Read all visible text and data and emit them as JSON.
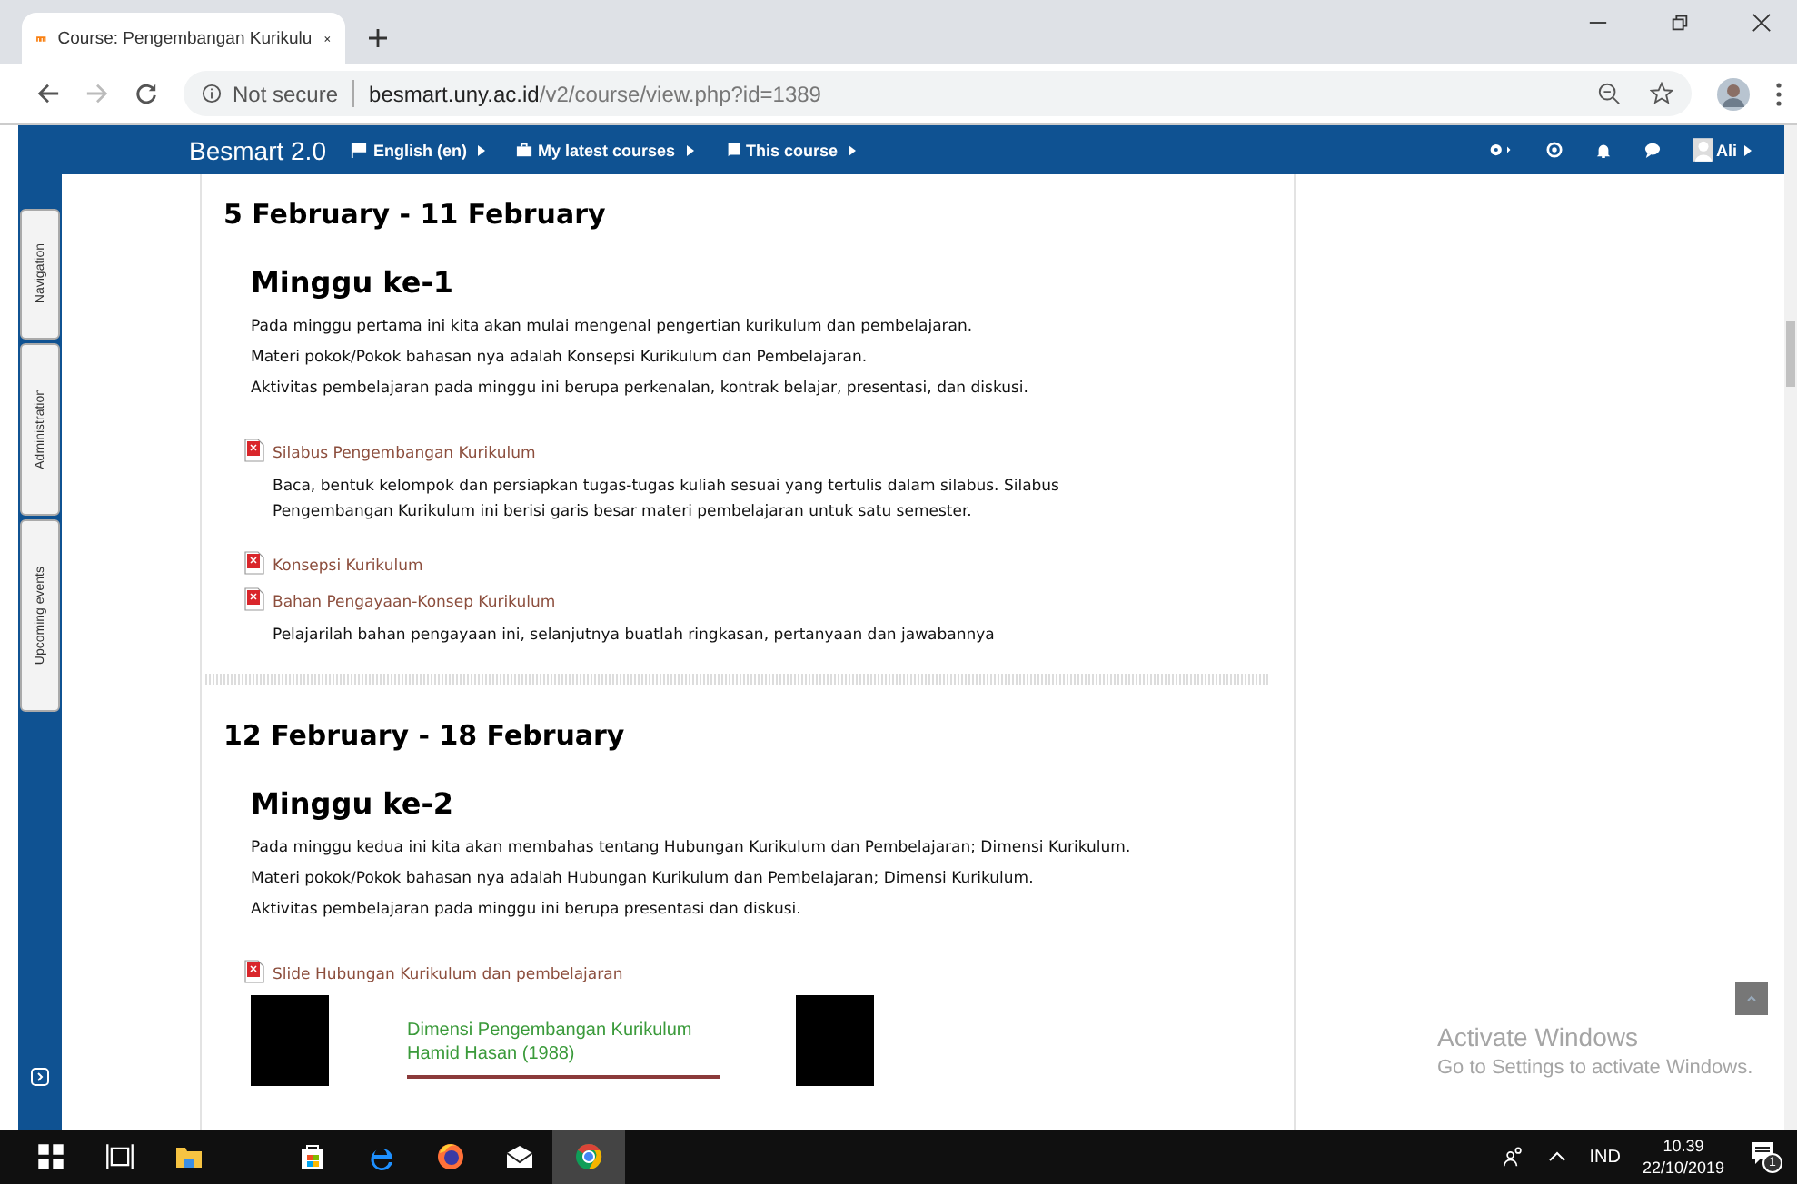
{
  "browser": {
    "tab_title": "Course: Pengembangan Kurikulu",
    "security": "Not secure",
    "url_host": "besmart.uny.ac.id",
    "url_path": "/v2/course/view.php?id=1389"
  },
  "navbar": {
    "brand": "Besmart 2.0",
    "menus": [
      {
        "kind": "flag",
        "label": "English (en)"
      },
      {
        "kind": "briefcase",
        "label": "My latest courses"
      },
      {
        "kind": "book",
        "label": "This course"
      }
    ],
    "user": "Ali"
  },
  "side_tabs": [
    "Navigation",
    "Administration",
    "Upcoming events"
  ],
  "sections": [
    {
      "date": "5 February - 11 February",
      "title": "Minggu ke-1",
      "paragraphs": [
        "Pada minggu pertama ini kita akan mulai mengenal pengertian kurikulum dan pembelajaran.",
        "Materi pokok/Pokok bahasan nya adalah Konsepsi Kurikulum dan Pembelajaran.",
        "Aktivitas pembelajaran pada minggu ini berupa perkenalan, kontrak belajar, presentasi, dan diskusi."
      ],
      "resources": [
        {
          "name": "Silabus Pengembangan Kurikulum",
          "description": "Baca, bentuk kelompok dan persiapkan tugas-tugas kuliah sesuai yang tertulis dalam silabus. Silabus Pengembangan Kurikulum ini berisi garis besar materi pembelajaran untuk satu semester."
        },
        {
          "name": "Konsepsi Kurikulum"
        },
        {
          "name": "Bahan Pengayaan-Konsep Kurikulum",
          "description": "Pelajarilah bahan pengayaan ini, selanjutnya buatlah ringkasan, pertanyaan dan jawabannya"
        }
      ]
    },
    {
      "date": "12 February - 18 February",
      "title": "Minggu ke-2",
      "paragraphs": [
        "Pada minggu kedua ini kita akan membahas tentang Hubungan Kurikulum dan Pembelajaran; Dimensi Kurikulum.",
        "Materi pokok/Pokok bahasan nya adalah Hubungan Kurikulum dan Pembelajaran; Dimensi Kurikulum.",
        "Aktivitas pembelajaran pada minggu ini berupa presentasi dan diskusi."
      ],
      "resources": [
        {
          "name": "Slide Hubungan Kurikulum dan pembelajaran",
          "slide_lines": [
            "Dimensi Pengembangan Kurikulum",
            "Hamid Hasan (1988)"
          ]
        }
      ]
    }
  ],
  "activation": {
    "title": "Activate Windows",
    "subtitle": "Go to Settings to activate Windows."
  },
  "taskbar": {
    "language": "IND",
    "time": "10.39",
    "date": "22/10/2019",
    "notifications": "1"
  }
}
